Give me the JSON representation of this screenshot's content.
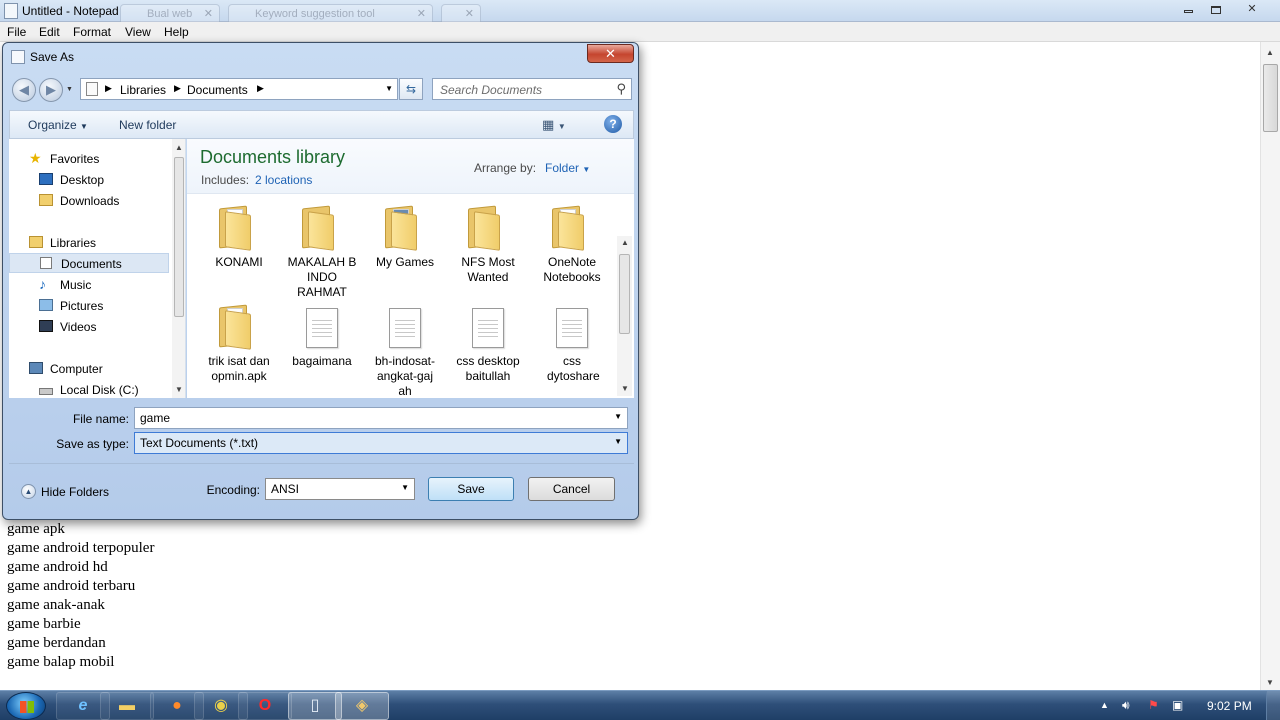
{
  "notepad": {
    "title": "Untitled - Notepad",
    "bg_tabs": [
      "Bual web",
      "Keyword suggestion tool"
    ],
    "menu": [
      "File",
      "Edit",
      "Format",
      "View",
      "Help"
    ],
    "lines": [
      "game apk",
      "game android terpopuler",
      "game android hd",
      "game android terbaru",
      "game anak-anak",
      "game barbie",
      "game berdandan",
      "game balap mobil"
    ]
  },
  "dialog": {
    "title": "Save As",
    "close_label": "✕",
    "breadcrumb": [
      "Libraries",
      "Documents"
    ],
    "search_placeholder": "Search Documents",
    "toolbar": {
      "organize": "Organize",
      "new_folder": "New folder",
      "help": "?"
    },
    "nav": {
      "favorites": "Favorites",
      "desktop": "Desktop",
      "downloads": "Downloads",
      "libraries": "Libraries",
      "documents": "Documents",
      "music": "Music",
      "pictures": "Pictures",
      "videos": "Videos",
      "computer": "Computer",
      "local_disk": "Local Disk (C:)"
    },
    "library": {
      "title": "Documents library",
      "includes_label": "Includes:",
      "locations": "2 locations",
      "arrange_label": "Arrange by:",
      "arrange_value": "Folder"
    },
    "items": [
      {
        "name": "KONAMI",
        "kind": "folder"
      },
      {
        "name": "MAKALAH B INDO RAHMAT",
        "kind": "folder"
      },
      {
        "name": "My Games",
        "kind": "folder"
      },
      {
        "name": "NFS Most Wanted",
        "kind": "folder"
      },
      {
        "name": "OneNote Notebooks",
        "kind": "folder"
      },
      {
        "name": "trik isat dan opmin.apk",
        "kind": "folder"
      },
      {
        "name": "bagaimana",
        "kind": "text-file"
      },
      {
        "name": "bh-indosat-angkat-gajah",
        "kind": "text-file"
      },
      {
        "name": "css desktop baitullah",
        "kind": "text-file"
      },
      {
        "name": "css dytoshare",
        "kind": "text-file"
      }
    ],
    "file_name_label": "File name:",
    "file_name": "game",
    "save_type_label": "Save as type:",
    "save_type": "Text Documents (*.txt)",
    "hide_folders": "Hide Folders",
    "encoding_label": "Encoding:",
    "encoding": "ANSI",
    "save": "Save",
    "cancel": "Cancel"
  },
  "taskbar": {
    "apps": [
      "ie-icon",
      "explorer-icon",
      "firefox-icon",
      "chrome-icon",
      "opera-icon",
      "notepad-icon",
      "paint-icon"
    ],
    "clock": "9:02 PM"
  }
}
